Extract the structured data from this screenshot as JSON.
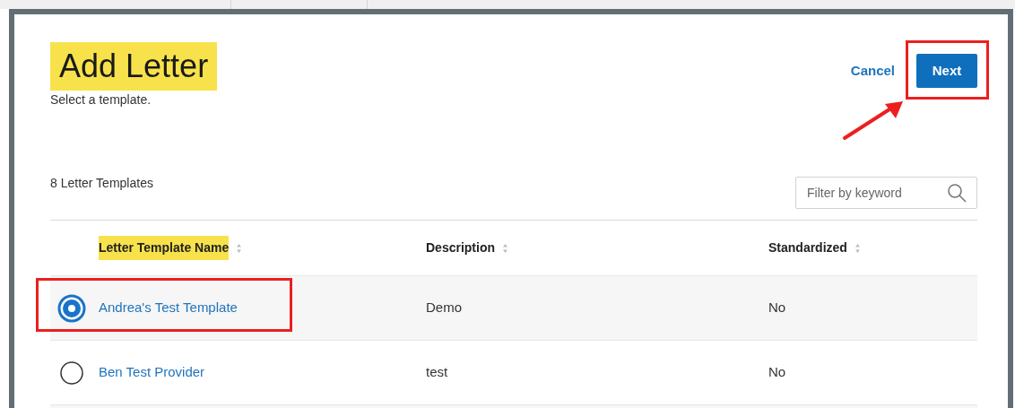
{
  "dialog": {
    "title": {
      "text": "Add Letter",
      "highlighted": true
    },
    "subtitle": "Select a template.",
    "actions": {
      "cancel": "Cancel",
      "next": {
        "label": "Next",
        "outlined": true
      },
      "pointer_arrow": true
    }
  },
  "table": {
    "count": "8 Letter Templates",
    "filter": {
      "placeholder": "Filter by keyword"
    },
    "columns": [
      {
        "label": "Letter Template Name",
        "highlighted": true
      },
      {
        "label": "Description",
        "highlighted": false
      },
      {
        "label": "Standardized",
        "highlighted": false
      }
    ],
    "rows": [
      {
        "name": "Andrea's Test Template",
        "description": "Demo",
        "standardized": "No",
        "selected": true,
        "outlined": true
      },
      {
        "name": "Ben Test Provider",
        "description": "test",
        "standardized": "No",
        "selected": false,
        "outlined": false
      }
    ]
  }
}
